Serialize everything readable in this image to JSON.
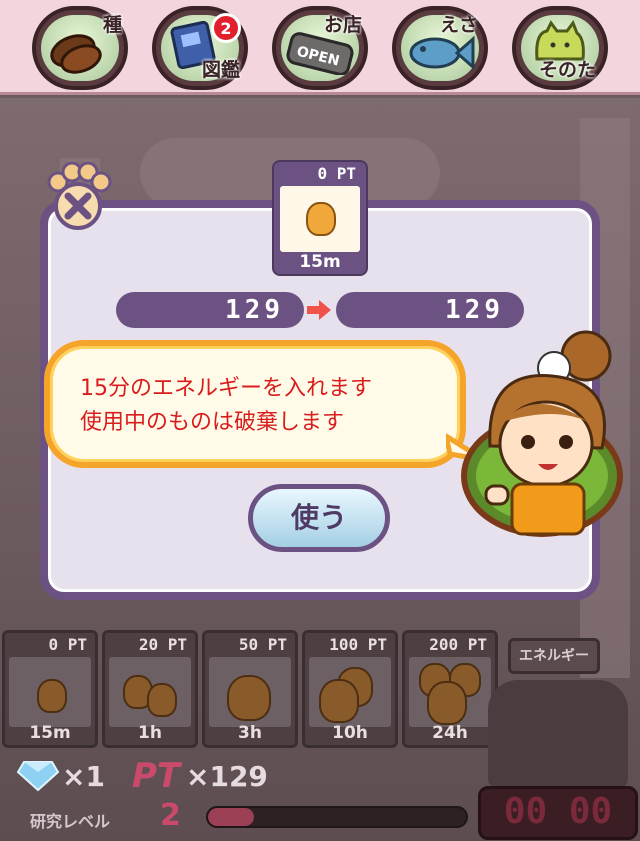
{
  "nav": {
    "items": [
      {
        "label": "種",
        "icon": "seed-icon"
      },
      {
        "label": "図鑑",
        "icon": "book-icon",
        "badge": "2"
      },
      {
        "label": "お店",
        "icon": "shop-sign-icon",
        "sign_text": "OPEN"
      },
      {
        "label": "えさ",
        "icon": "fish-icon"
      },
      {
        "label": "そのた",
        "icon": "cat-icon"
      }
    ]
  },
  "dialog": {
    "item": {
      "pt": "0 PT",
      "time": "15m"
    },
    "from_value": "129",
    "to_value": "129",
    "message": [
      "15分のエネルギーを入れます",
      "使用中のものは破棄します"
    ],
    "use_label": "使う"
  },
  "tray": [
    {
      "pt": "0 PT",
      "time": "15m",
      "count": 1
    },
    {
      "pt": "20 PT",
      "time": "1h",
      "count": 2
    },
    {
      "pt": "50 PT",
      "time": "3h",
      "count": 2
    },
    {
      "pt": "100 PT",
      "time": "10h",
      "count": 3
    },
    {
      "pt": "200 PT",
      "time": "24h",
      "count": 4
    }
  ],
  "energy_label": "エネルギー",
  "status": {
    "gems": "×1",
    "pt_label": "PT",
    "pt_count": "×129",
    "level_label": "研究レベル",
    "level": "2",
    "level_progress": 0.18,
    "timer": "00 00"
  },
  "colors": {
    "accent": "#6b5283",
    "bubble_border": "#f5a42a",
    "message_text": "#d91d1d",
    "badge": "#e21f2c"
  }
}
